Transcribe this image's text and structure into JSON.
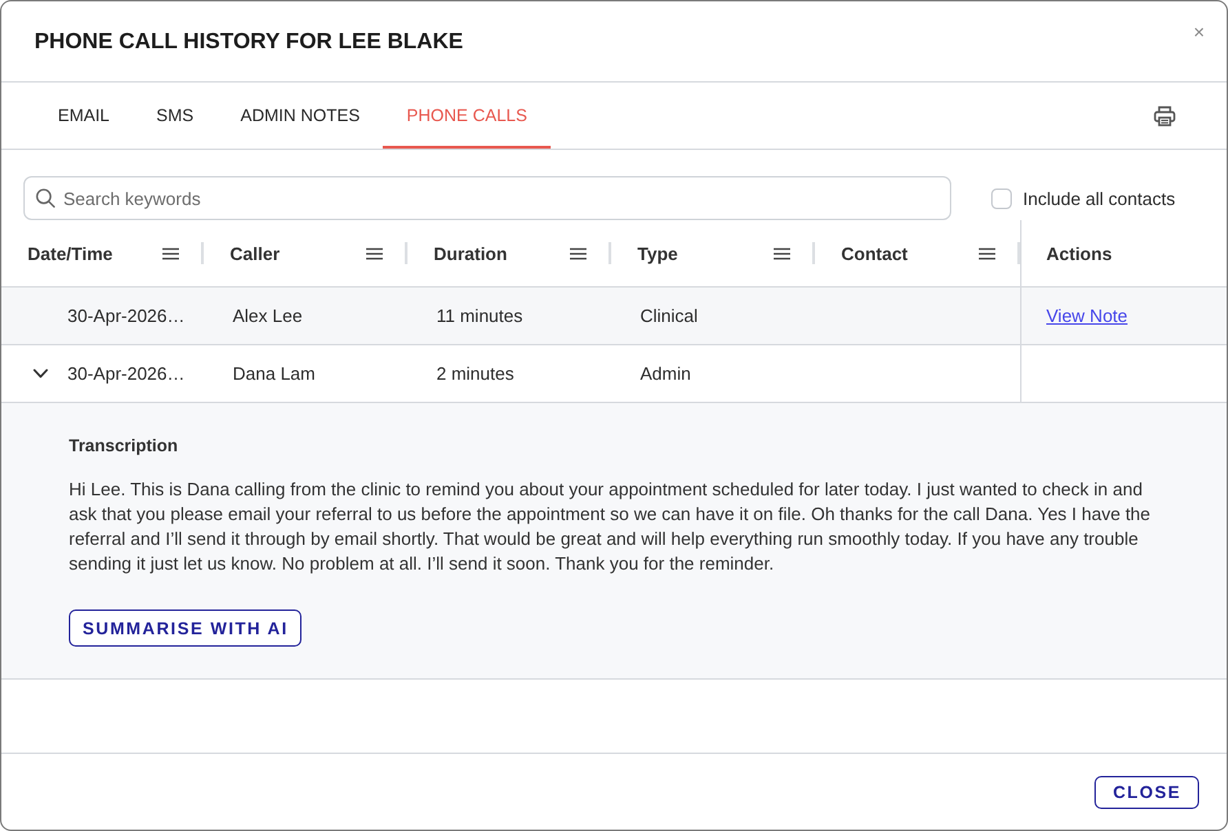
{
  "dialog": {
    "title": "PHONE CALL HISTORY FOR LEE BLAKE",
    "close_glyph": "×"
  },
  "tabs": [
    {
      "label": "EMAIL",
      "selected": false
    },
    {
      "label": "SMS",
      "selected": false
    },
    {
      "label": "ADMIN NOTES",
      "selected": false
    },
    {
      "label": "PHONE CALLS",
      "selected": true
    }
  ],
  "search": {
    "placeholder": "Search keywords"
  },
  "include_all_contacts": {
    "label": "Include all contacts",
    "checked": false
  },
  "table": {
    "columns": [
      {
        "label": "Date/Time",
        "menu": true
      },
      {
        "label": "Caller",
        "menu": true
      },
      {
        "label": "Duration",
        "menu": true
      },
      {
        "label": "Type",
        "menu": true
      },
      {
        "label": "Contact",
        "menu": true
      },
      {
        "label": "Actions",
        "menu": false
      }
    ],
    "rows": [
      {
        "date_time": "30-Apr-2026…",
        "caller": "Alex Lee",
        "duration": "11 minutes",
        "type": "Clinical",
        "action": "View Note",
        "highlighted": true,
        "expandable": false
      },
      {
        "date_time": "30-Apr-2026…",
        "caller": "Dana Lam",
        "duration": "2 minutes",
        "type": "Admin",
        "highlighted": false,
        "expandable": true,
        "expanded": true,
        "detail": {
          "heading": "Transcription",
          "text": "Hi Lee. This is Dana calling from the clinic to remind you about your appointment scheduled for later today. I just wanted to check in and ask that you please email your referral to us before the appointment so we can have it on file. Oh thanks for the call Dana. Yes I have the referral and I’ll send it through by email shortly. That would be great and will help everything run smoothly today. If you have any trouble sending it just let us know. No problem at all. I’ll send it soon. Thank you for the reminder.",
          "button": "SUMMARISE WITH AI"
        }
      }
    ]
  },
  "footer": {
    "buttons": [
      "CLOSE"
    ]
  }
}
